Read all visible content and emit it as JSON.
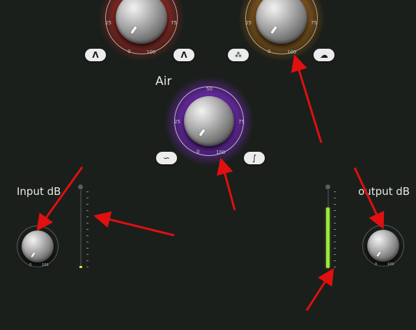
{
  "colors": {
    "background": "#1b1f1b",
    "top_left_glow": "#e0302a",
    "top_right_glow": "#e58a1e",
    "air_glow": "#8a2be2",
    "meter_level": "#9be63c",
    "annotation_arrow": "#e01010"
  },
  "top_left_knob": {
    "scale": {
      "min": "0",
      "q1": "25",
      "q3": "75",
      "max": "100"
    },
    "buttons": [
      {
        "icon": "bell-curve-icon",
        "glyph": "Λ"
      },
      {
        "icon": "bell-curve-icon",
        "glyph": "Λ"
      }
    ]
  },
  "top_right_knob": {
    "scale": {
      "min": "0",
      "q1": "25",
      "q3": "75",
      "max": "100"
    },
    "buttons": [
      {
        "icon": "dense-texture-icon",
        "glyph": "⁂"
      },
      {
        "icon": "cloud-icon",
        "glyph": "☁"
      }
    ]
  },
  "air": {
    "label": "Air",
    "scale": {
      "top": "50",
      "q1": "25",
      "q3": "75",
      "min": "0",
      "max": "100"
    },
    "buttons": [
      {
        "icon": "high-cut-curve-icon",
        "glyph": "∽"
      },
      {
        "icon": "high-shelf-curve-icon",
        "glyph": "∫"
      }
    ]
  },
  "input": {
    "label": "Input dB",
    "scale": {
      "min": "0",
      "max": "100"
    },
    "meter_level": 0.02
  },
  "output": {
    "label": "output dB",
    "scale": {
      "min": "0",
      "max": "100"
    },
    "meter_level": 0.78
  }
}
